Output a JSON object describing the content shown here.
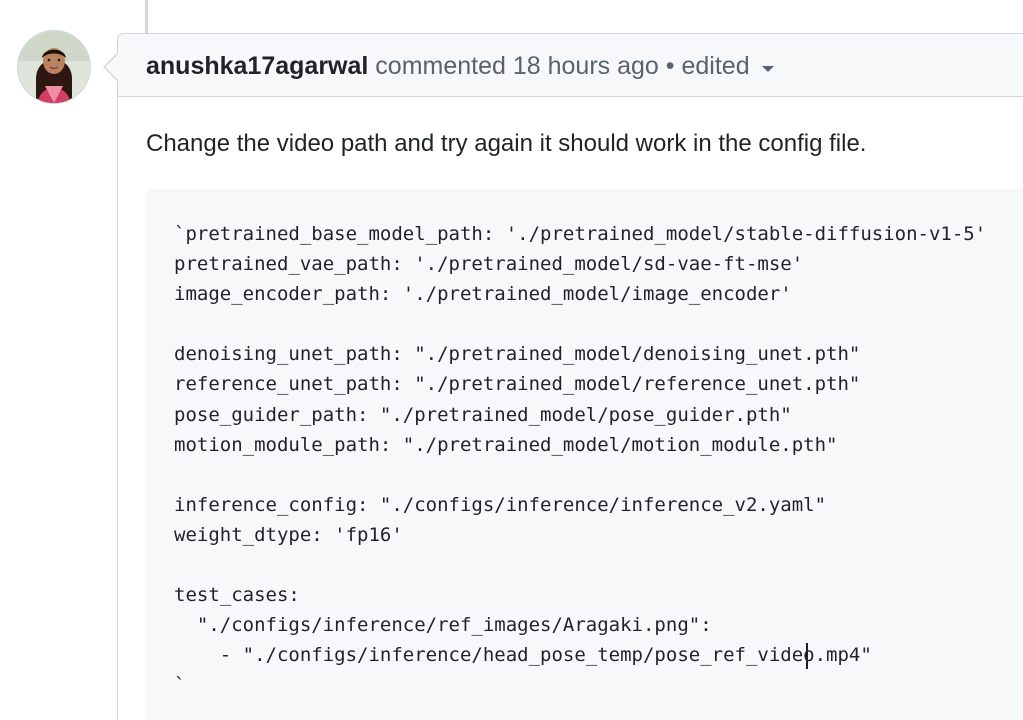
{
  "comment": {
    "author": "anushka17agarwal",
    "action": "commented",
    "timestamp": "18 hours ago",
    "separator": "•",
    "edited_label": "edited",
    "body": "Change the video path and try again it should work in the config file."
  },
  "code_lines": [
    "`pretrained_base_model_path: './pretrained_model/stable-diffusion-v1-5'",
    "pretrained_vae_path: './pretrained_model/sd-vae-ft-mse'",
    "image_encoder_path: './pretrained_model/image_encoder'",
    "",
    "denoising_unet_path: \"./pretrained_model/denoising_unet.pth\"",
    "reference_unet_path: \"./pretrained_model/reference_unet.pth\"",
    "pose_guider_path: \"./pretrained_model/pose_guider.pth\"",
    "motion_module_path: \"./pretrained_model/motion_module.pth\"",
    "",
    "inference_config: \"./configs/inference/inference_v2.yaml\"",
    "weight_dtype: 'fp16'",
    "",
    "test_cases:",
    "  \"./configs/inference/ref_images/Aragaki.png\":",
    "    - \"./configs/inference/head_pose_temp/pose_ref_video.mp4\"",
    "`"
  ],
  "icons": {
    "avatar": "user-avatar-photo",
    "edited_menu": "chevron-down-icon"
  },
  "colors": {
    "border": "#d0d7de",
    "header_bg": "#f6f8fa",
    "muted_text": "#59636e",
    "primary_text": "#1f2328",
    "code_bg": "#f6f8fa"
  }
}
